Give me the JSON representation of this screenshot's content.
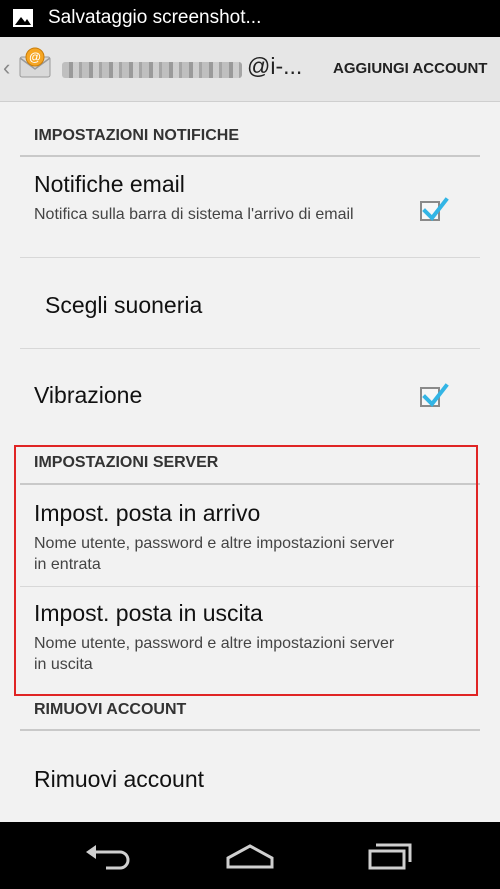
{
  "status_bar": {
    "text": "Salvataggio screenshot...",
    "icon": "image-icon"
  },
  "action_bar": {
    "account_suffix": "@i-...",
    "add_account_label": "AGGIUNGI ACCOUNT",
    "app_icon": "email-app-icon"
  },
  "sections": {
    "notifications": {
      "header": "IMPOSTAZIONI NOTIFICHE",
      "email_notifications": {
        "title": "Notifiche email",
        "summary": "Notifica sulla barra di sistema l'arrivo di email",
        "checked": true
      },
      "ringtone": {
        "title": "Scegli suoneria"
      },
      "vibration": {
        "title": "Vibrazione",
        "checked": true
      }
    },
    "server": {
      "header": "IMPOSTAZIONI SERVER",
      "incoming": {
        "title": "Impost. posta in arrivo",
        "summary": "Nome utente, password e altre impostazioni server in entrata"
      },
      "outgoing": {
        "title": "Impost. posta in uscita",
        "summary": "Nome utente, password e altre impostazioni server in uscita"
      }
    },
    "remove": {
      "header": "RIMUOVI ACCOUNT",
      "remove_account": {
        "title": "Rimuovi account"
      }
    }
  },
  "colors": {
    "checkmark": "#33b5e5",
    "highlight_border": "#e02424",
    "background": "#f2f2f2"
  },
  "nav_icons": [
    "back-icon",
    "home-icon",
    "recent-apps-icon"
  ]
}
